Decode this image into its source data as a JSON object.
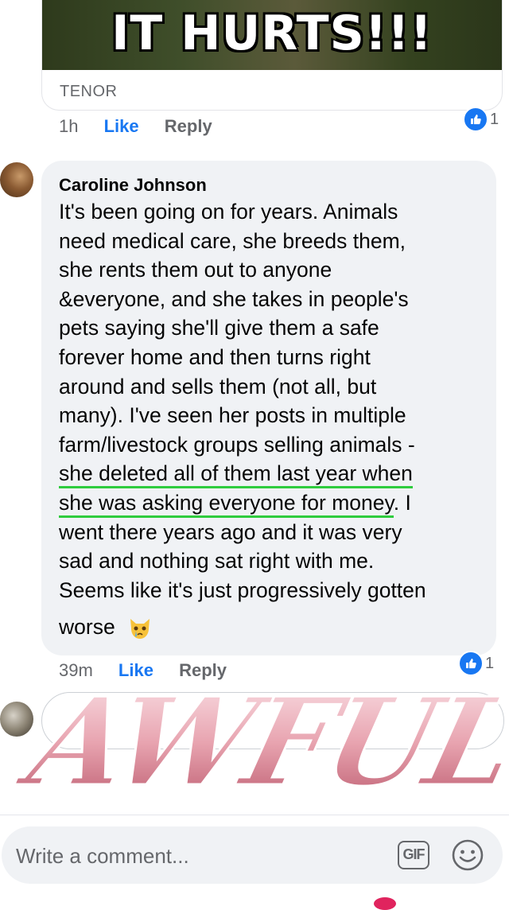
{
  "gif_comment": {
    "caption": "IT HURTS!!!",
    "source": "TENOR",
    "time": "1h",
    "like_label": "Like",
    "reply_label": "Reply",
    "reaction_count": "1"
  },
  "comment": {
    "author": "Caroline Johnson",
    "lines": [
      "It's been going on for years. Animals",
      "need medical care, she breeds them,",
      "she rents them out to anyone",
      "&everyone, and she takes in people's",
      "pets saying she'll give them a safe",
      "forever home and then turns right",
      "around and sells them (not all, but",
      "many). I've seen her posts in multiple",
      "farm/livestock groups selling animals -"
    ],
    "underlined_1": "she deleted all of them last year when",
    "underlined_2": "she was asking everyone for money",
    "after_underline": ". I",
    "lines_after": [
      "went there years ago and it was very",
      "sad and nothing sat right with me.",
      "Seems like it's just progressively gotten"
    ],
    "last_line": "worse",
    "emoji": "crying-cat-face",
    "time": "39m",
    "like_label": "Like",
    "reply_label": "Reply",
    "reaction_count": "1"
  },
  "sticker_text": "AWFUL",
  "composer": {
    "placeholder": "Write a comment...",
    "gif_label": "GIF"
  },
  "colors": {
    "accent": "#1877f2",
    "underline": "#2fcc3e",
    "sticker_pink": "#e8a4b0"
  }
}
